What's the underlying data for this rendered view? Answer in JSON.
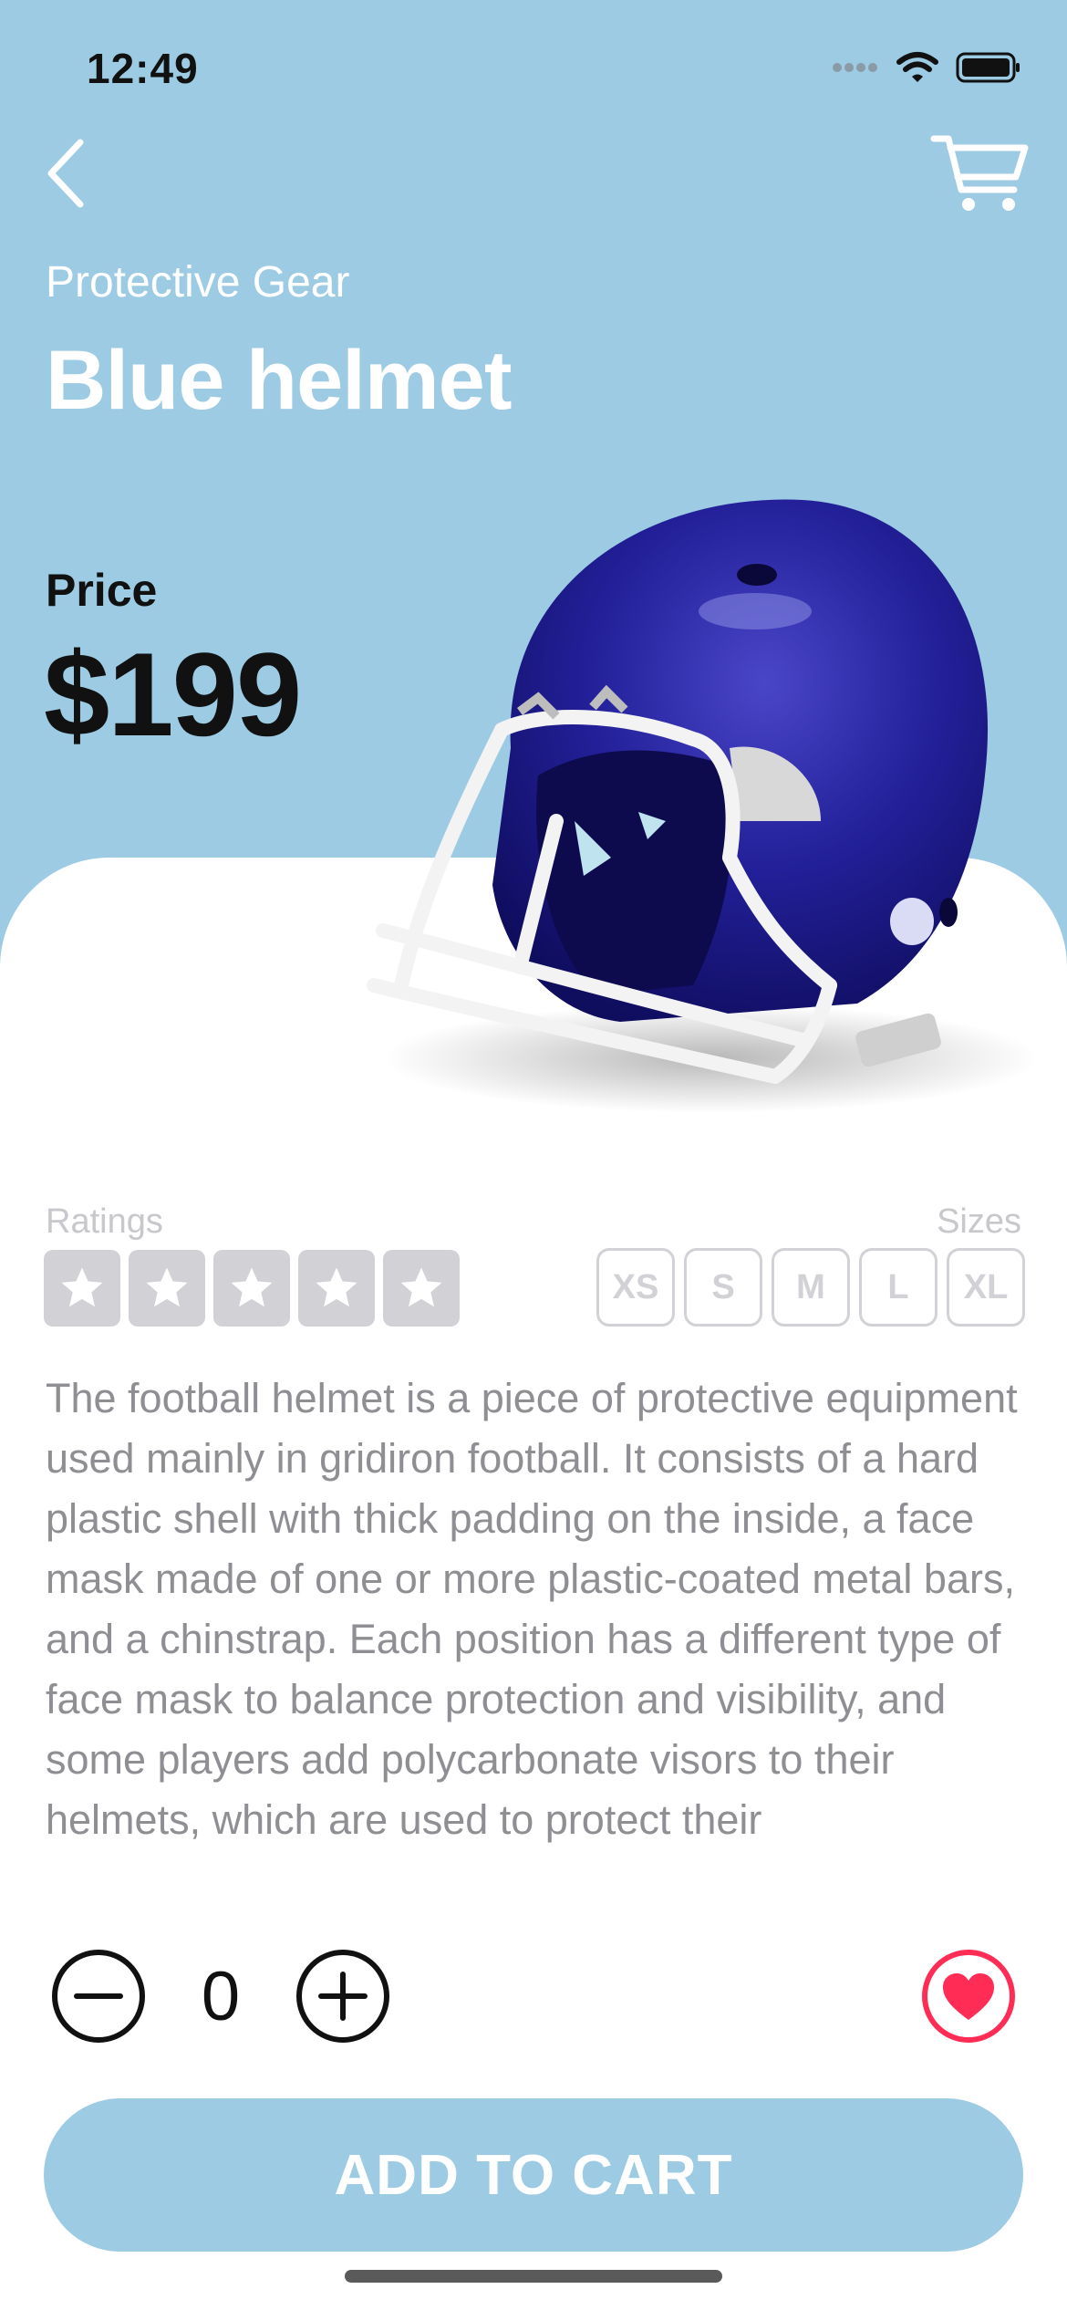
{
  "status_bar": {
    "time": "12:49"
  },
  "header": {
    "category": "Protective Gear",
    "title": "Blue helmet"
  },
  "price": {
    "label": "Price",
    "value": "$199"
  },
  "ratings": {
    "label": "Ratings",
    "max": 5,
    "filled": 0
  },
  "sizes": {
    "label": "Sizes",
    "options": [
      "XS",
      "S",
      "M",
      "L",
      "XL"
    ]
  },
  "description": "The football helmet is a piece of protective equipment used mainly in gridiron football. It consists of a hard plastic shell with thick padding on the inside, a face mask made of one or more plastic-coated metal bars, and a chinstrap. Each position has a different type of face mask to balance protection and visibility, and some players add polycarbonate visors to their helmets, which are used to protect their",
  "quantity": {
    "value": "0"
  },
  "cta": {
    "label": "ADD TO CART"
  },
  "colors": {
    "background": "#9ccbe3",
    "accent": "#ff2d55",
    "product": "#1e1b8c"
  },
  "icons": [
    "back-chevron-icon",
    "cart-icon",
    "minus-icon",
    "plus-icon",
    "heart-icon",
    "star-icon",
    "helmet-image"
  ]
}
